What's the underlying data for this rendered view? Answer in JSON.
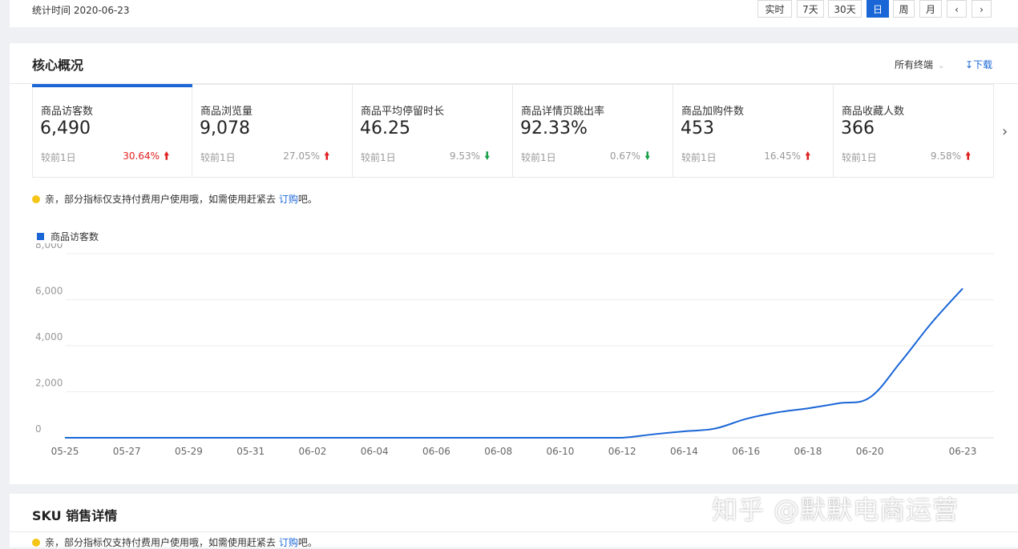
{
  "header": {
    "stat_time": "统计时间 2020-06-23",
    "range_buttons": [
      "实时",
      "7天",
      "30天",
      "日",
      "周",
      "月"
    ],
    "active_range": "日",
    "prev_icon": "chevron-left-icon",
    "next_icon": "chevron-right-icon"
  },
  "core": {
    "title": "核心概况",
    "terminal_select": "所有终端",
    "download": "下载",
    "kpis": [
      {
        "label": "商品访客数",
        "value": "6,490",
        "compare": "较前1日",
        "pct": "30.64%",
        "trend": "up",
        "active": true
      },
      {
        "label": "商品浏览量",
        "value": "9,078",
        "compare": "较前1日",
        "pct": "27.05%",
        "trend": "up"
      },
      {
        "label": "商品平均停留时长",
        "value": "46.25",
        "compare": "较前1日",
        "pct": "9.53%",
        "trend": "down"
      },
      {
        "label": "商品详情页跳出率",
        "value": "92.33%",
        "compare": "较前1日",
        "pct": "0.67%",
        "trend": "down"
      },
      {
        "label": "商品加购件数",
        "value": "453",
        "compare": "较前1日",
        "pct": "16.45%",
        "trend": "up"
      },
      {
        "label": "商品收藏人数",
        "value": "366",
        "compare": "较前1日",
        "pct": "9.58%",
        "trend": "up"
      }
    ],
    "notice": {
      "text": "亲，部分指标仅支持付费用户使用哦，如需使用赶紧去 ",
      "link": "订购",
      "suffix": "吧。"
    }
  },
  "chart_data": {
    "type": "line",
    "title": "",
    "xlabel": "",
    "ylabel": "",
    "ylim": [
      0,
      8000
    ],
    "yticks": [
      "0",
      "2,000",
      "4,000",
      "6,000",
      "8,000"
    ],
    "xticks": [
      "05-25",
      "05-27",
      "05-29",
      "05-31",
      "06-02",
      "06-04",
      "06-06",
      "06-08",
      "06-10",
      "06-12",
      "06-14",
      "06-16",
      "06-18",
      "06-20",
      "06-23"
    ],
    "series": [
      {
        "name": "商品访客数",
        "color": "#1a66d6",
        "x": [
          "05-25",
          "05-26",
          "05-27",
          "05-28",
          "05-29",
          "05-30",
          "05-31",
          "06-01",
          "06-02",
          "06-03",
          "06-04",
          "06-05",
          "06-06",
          "06-07",
          "06-08",
          "06-09",
          "06-10",
          "06-11",
          "06-12",
          "06-13",
          "06-14",
          "06-15",
          "06-16",
          "06-17",
          "06-18",
          "06-19",
          "06-20",
          "06-21",
          "06-22",
          "06-23"
        ],
        "values": [
          0,
          0,
          0,
          0,
          0,
          0,
          0,
          0,
          0,
          0,
          0,
          0,
          0,
          0,
          0,
          0,
          0,
          0,
          0,
          150,
          280,
          400,
          820,
          1100,
          1280,
          1500,
          1750,
          3300,
          5000,
          6490
        ]
      }
    ],
    "grid": true,
    "legend_position": "top-left"
  },
  "sku": {
    "title": "SKU 销售详情",
    "notice": {
      "text": "亲，部分指标仅支持付费用户使用哦，如需使用赶紧去 ",
      "link": "订购",
      "suffix": "吧。"
    }
  },
  "watermark": "知乎 @默默电商运营"
}
